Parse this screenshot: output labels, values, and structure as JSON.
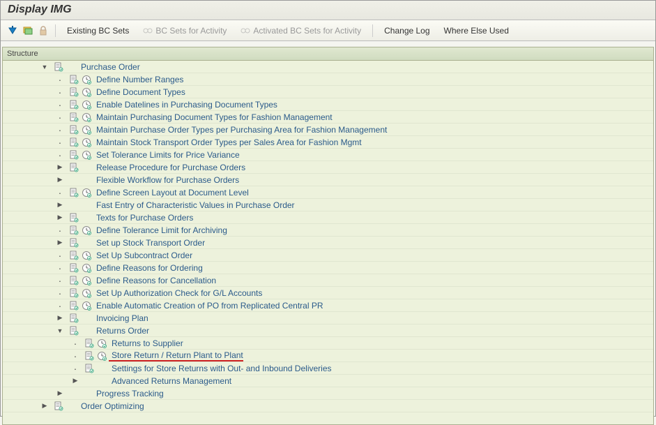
{
  "header": {
    "title": "Display IMG"
  },
  "toolbar": {
    "existing_bc_sets": "Existing BC Sets",
    "bc_sets_activity": "BC Sets for Activity",
    "activated_bc_sets": "Activated BC Sets for Activity",
    "change_log": "Change Log",
    "where_else_used": "Where Else Used"
  },
  "structure_label": "Structure",
  "tree": [
    {
      "level": 0,
      "toggle": "expanded",
      "doc": true,
      "clock": false,
      "label": "Purchase Order"
    },
    {
      "level": 1,
      "toggle": "leaf",
      "doc": true,
      "clock": true,
      "label": "Define Number Ranges"
    },
    {
      "level": 1,
      "toggle": "leaf",
      "doc": true,
      "clock": true,
      "label": "Define Document Types"
    },
    {
      "level": 1,
      "toggle": "leaf",
      "doc": true,
      "clock": true,
      "label": "Enable Datelines in Purchasing Document Types"
    },
    {
      "level": 1,
      "toggle": "leaf",
      "doc": true,
      "clock": true,
      "label": "Maintain Purchasing Document Types for Fashion Management"
    },
    {
      "level": 1,
      "toggle": "leaf",
      "doc": true,
      "clock": true,
      "label": "Maintain Purchase Order Types per Purchasing Area for Fashion Management"
    },
    {
      "level": 1,
      "toggle": "leaf",
      "doc": true,
      "clock": true,
      "label": "Maintain Stock Transport Order Types per Sales Area for Fashion Mgmt"
    },
    {
      "level": 1,
      "toggle": "leaf",
      "doc": true,
      "clock": true,
      "label": "Set Tolerance Limits for Price Variance"
    },
    {
      "level": 1,
      "toggle": "collapsed",
      "doc": true,
      "clock": false,
      "label": "Release Procedure for Purchase Orders"
    },
    {
      "level": 1,
      "toggle": "collapsed",
      "doc": false,
      "clock": false,
      "label": "Flexible Workflow for Purchase Orders"
    },
    {
      "level": 1,
      "toggle": "leaf",
      "doc": true,
      "clock": true,
      "label": "Define Screen Layout at Document Level"
    },
    {
      "level": 1,
      "toggle": "collapsed",
      "doc": false,
      "clock": false,
      "label": "Fast Entry of Characteristic Values in Purchase Order"
    },
    {
      "level": 1,
      "toggle": "collapsed",
      "doc": true,
      "clock": false,
      "label": "Texts for Purchase Orders"
    },
    {
      "level": 1,
      "toggle": "leaf",
      "doc": true,
      "clock": true,
      "label": "Define Tolerance Limit for Archiving"
    },
    {
      "level": 1,
      "toggle": "collapsed",
      "doc": true,
      "clock": false,
      "label": "Set up Stock Transport Order"
    },
    {
      "level": 1,
      "toggle": "leaf",
      "doc": true,
      "clock": true,
      "label": "Set Up Subcontract Order"
    },
    {
      "level": 1,
      "toggle": "leaf",
      "doc": true,
      "clock": true,
      "label": "Define Reasons for Ordering"
    },
    {
      "level": 1,
      "toggle": "leaf",
      "doc": true,
      "clock": true,
      "label": "Define Reasons for Cancellation"
    },
    {
      "level": 1,
      "toggle": "leaf",
      "doc": true,
      "clock": true,
      "label": "Set Up Authorization Check for G/L Accounts"
    },
    {
      "level": 1,
      "toggle": "leaf",
      "doc": true,
      "clock": true,
      "label": "Enable Automatic Creation of PO from Replicated Central PR"
    },
    {
      "level": 1,
      "toggle": "collapsed",
      "doc": true,
      "clock": false,
      "label": "Invoicing Plan"
    },
    {
      "level": 1,
      "toggle": "expanded",
      "doc": true,
      "clock": false,
      "label": "Returns Order"
    },
    {
      "level": 2,
      "toggle": "leaf",
      "doc": true,
      "clock": true,
      "label": "Returns to Supplier"
    },
    {
      "level": 2,
      "toggle": "leaf",
      "doc": true,
      "clock": true,
      "label": "Store Return / Return Plant to Plant",
      "highlight": true
    },
    {
      "level": 2,
      "toggle": "leaf",
      "doc": true,
      "clock": false,
      "label": "Settings for Store Returns with Out- and Inbound Deliveries"
    },
    {
      "level": 2,
      "toggle": "collapsed",
      "doc": false,
      "clock": false,
      "label": "Advanced Returns Management"
    },
    {
      "level": 1,
      "toggle": "collapsed",
      "doc": false,
      "clock": false,
      "label": "Progress Tracking"
    },
    {
      "level": 0,
      "toggle": "collapsed",
      "doc": true,
      "clock": false,
      "label": "Order Optimizing"
    }
  ]
}
